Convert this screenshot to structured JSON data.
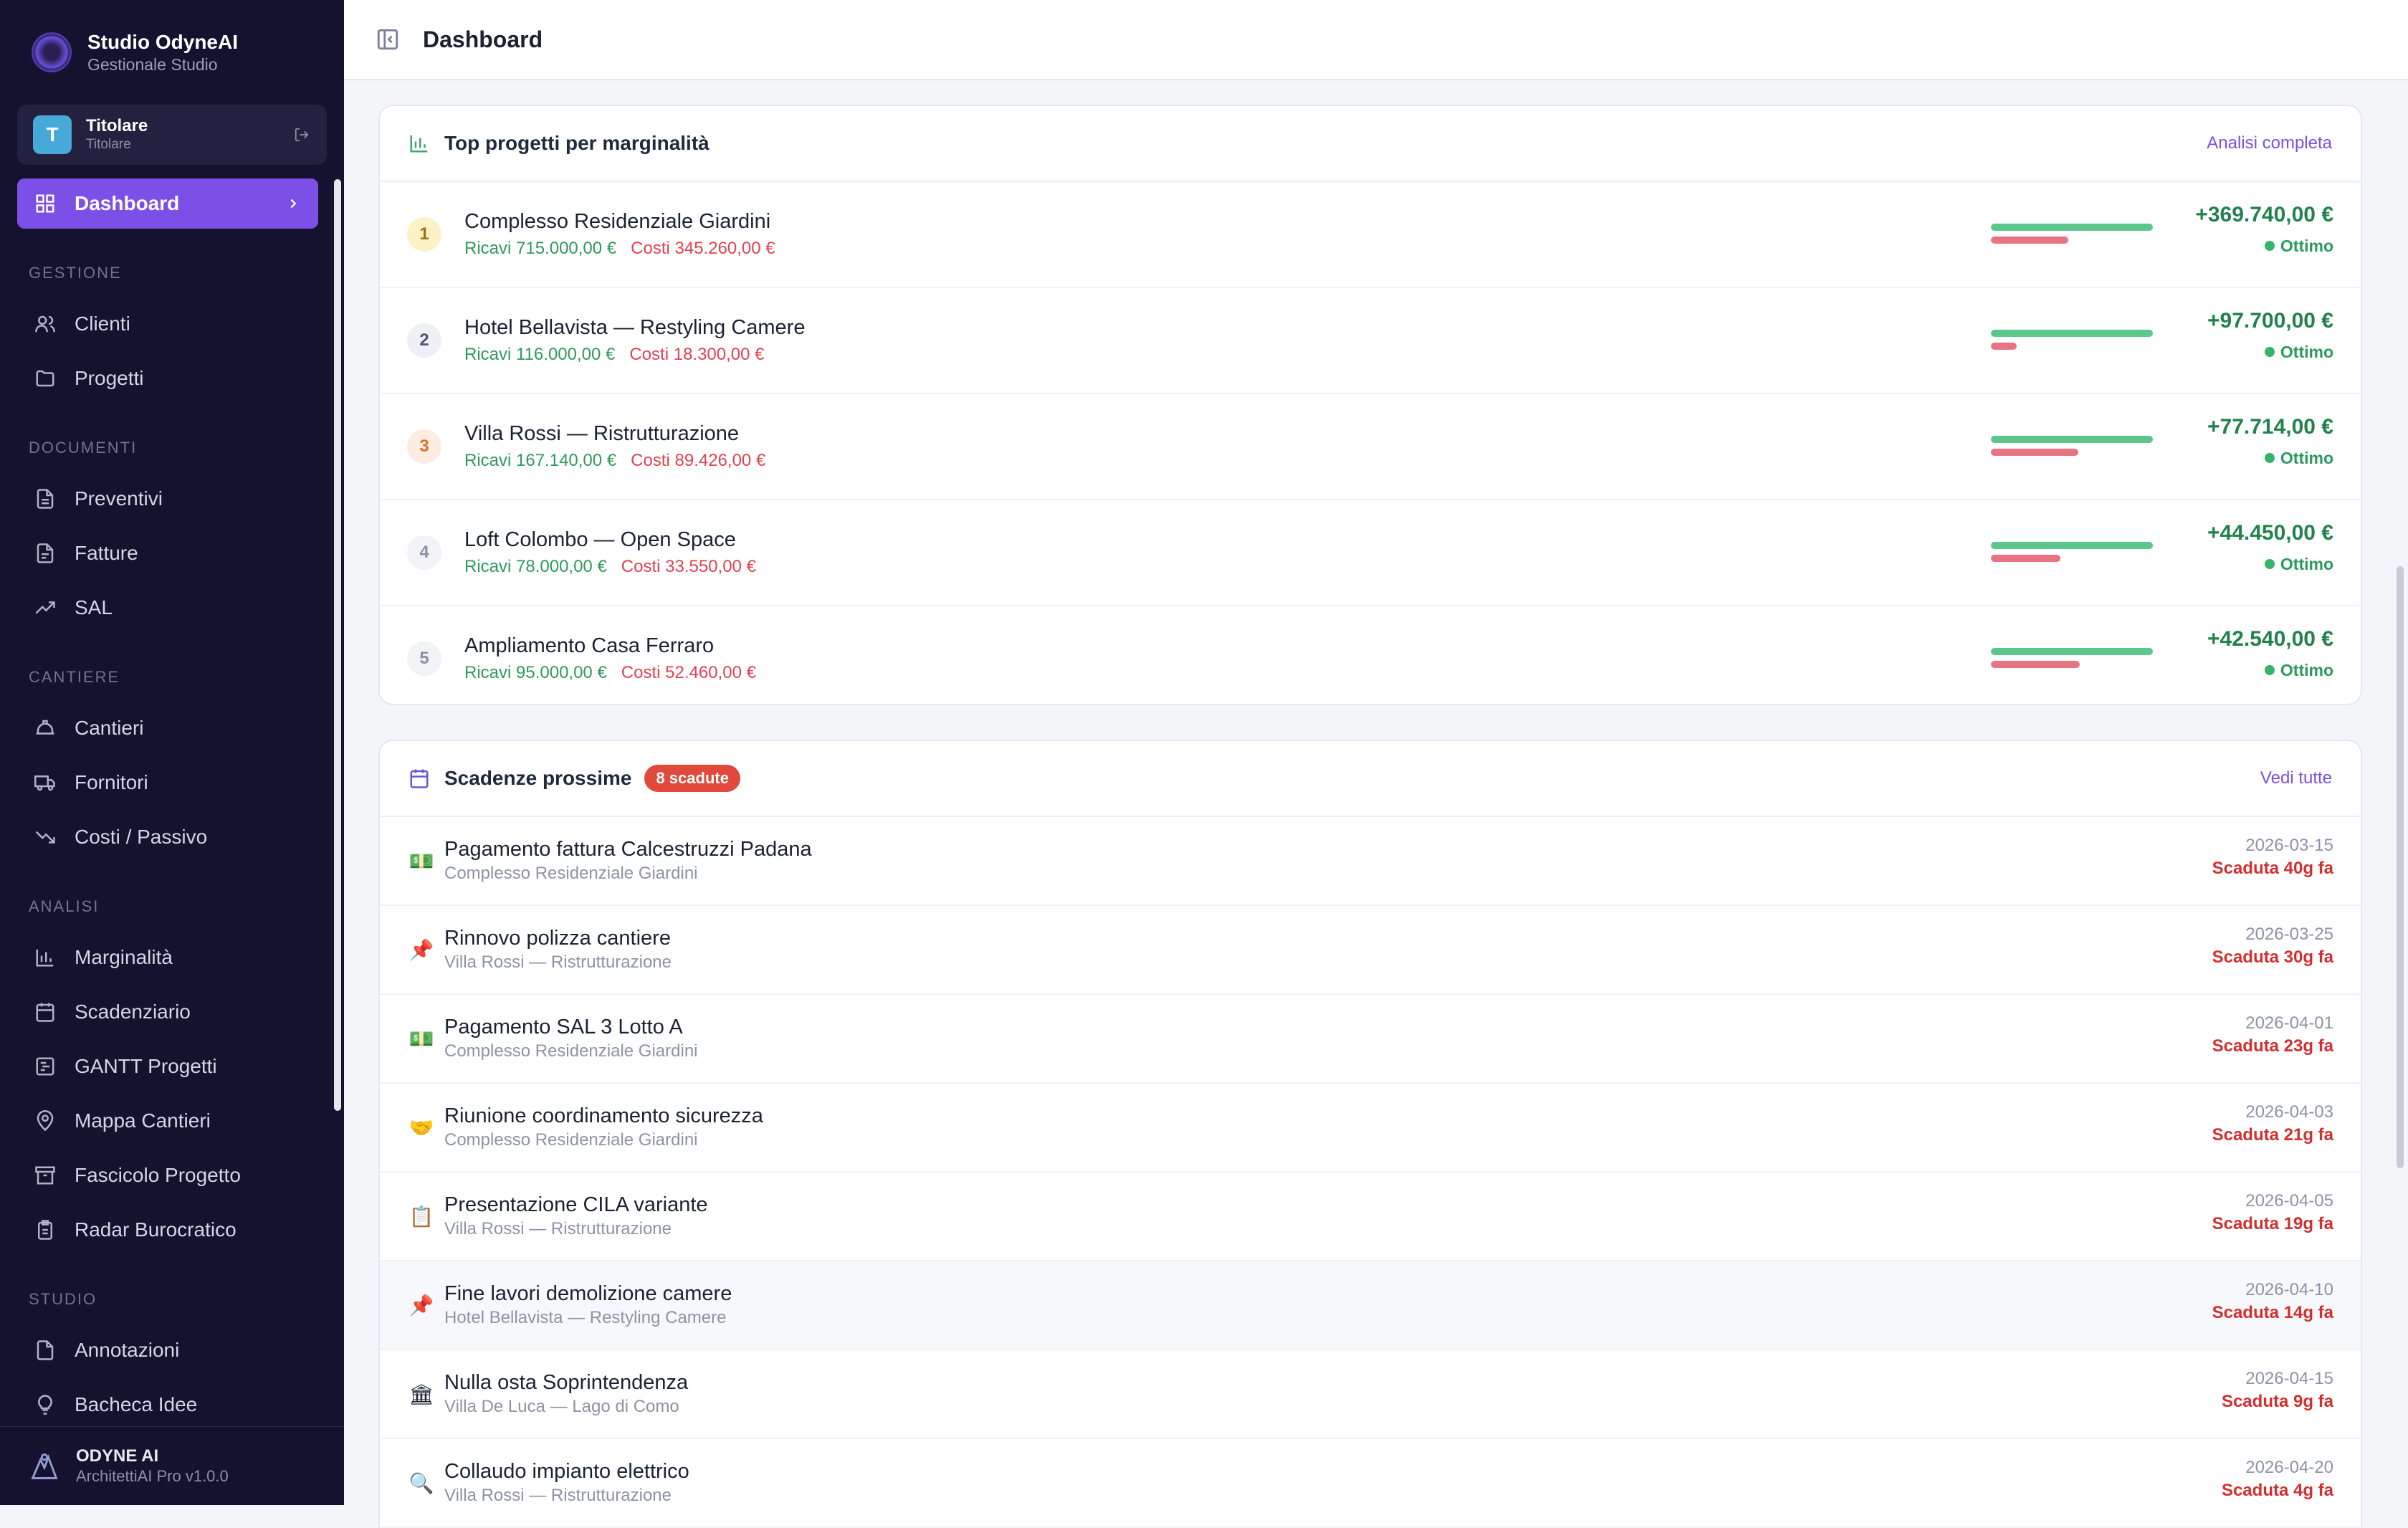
{
  "brand": {
    "title": "Studio OdyneAI",
    "subtitle": "Gestionale Studio"
  },
  "user": {
    "initial": "T",
    "name": "Titolare",
    "role": "Titolare"
  },
  "nav": {
    "active": "Dashboard",
    "sections": [
      {
        "title": "GESTIONE",
        "items": [
          "Clienti",
          "Progetti"
        ]
      },
      {
        "title": "DOCUMENTI",
        "items": [
          "Preventivi",
          "Fatture",
          "SAL"
        ]
      },
      {
        "title": "CANTIERE",
        "items": [
          "Cantieri",
          "Fornitori",
          "Costi / Passivo"
        ]
      },
      {
        "title": "ANALISI",
        "items": [
          "Marginalità",
          "Scadenziario",
          "GANTT Progetti",
          "Mappa Cantieri",
          "Fascicolo Progetto",
          "Radar Burocratico"
        ]
      },
      {
        "title": "STUDIO",
        "items": [
          "Annotazioni",
          "Bacheca Idee"
        ]
      }
    ]
  },
  "footer": {
    "title": "ODYNE AI",
    "subtitle": "ArchitettiAI Pro v1.0.0"
  },
  "topbar": {
    "title": "Dashboard"
  },
  "top_projects": {
    "title": "Top progetti per marginalità",
    "link": "Analisi completa",
    "rows": [
      {
        "rank": "1",
        "name": "Complesso Residenziale Giardini",
        "ricavi": "Ricavi 715.000,00 €",
        "costi": "Costi 345.260,00 €",
        "margin": "+369.740,00 €",
        "status": "Ottimo",
        "revenue_share": 1.0,
        "cost_share": 0.48
      },
      {
        "rank": "2",
        "name": "Hotel Bellavista — Restyling Camere",
        "ricavi": "Ricavi 116.000,00 €",
        "costi": "Costi 18.300,00 €",
        "margin": "+97.700,00 €",
        "status": "Ottimo",
        "revenue_share": 1.0,
        "cost_share": 0.16
      },
      {
        "rank": "3",
        "name": "Villa Rossi — Ristrutturazione",
        "ricavi": "Ricavi 167.140,00 €",
        "costi": "Costi 89.426,00 €",
        "margin": "+77.714,00 €",
        "status": "Ottimo",
        "revenue_share": 1.0,
        "cost_share": 0.54
      },
      {
        "rank": "4",
        "name": "Loft Colombo — Open Space",
        "ricavi": "Ricavi 78.000,00 €",
        "costi": "Costi 33.550,00 €",
        "margin": "+44.450,00 €",
        "status": "Ottimo",
        "revenue_share": 1.0,
        "cost_share": 0.43
      },
      {
        "rank": "5",
        "name": "Ampliamento Casa Ferraro",
        "ricavi": "Ricavi 95.000,00 €",
        "costi": "Costi 52.460,00 €",
        "margin": "+42.540,00 €",
        "status": "Ottimo",
        "revenue_share": 1.0,
        "cost_share": 0.55
      }
    ]
  },
  "deadlines": {
    "title": "Scadenze prossime",
    "badge": "8 scadute",
    "link": "Vedi tutte",
    "rows": [
      {
        "icon": "💵",
        "title": "Pagamento fattura Calcestruzzi Padana",
        "project": "Complesso Residenziale Giardini",
        "date": "2026-03-15",
        "status": "Scaduta 40g fa"
      },
      {
        "icon": "📌",
        "title": "Rinnovo polizza cantiere",
        "project": "Villa Rossi — Ristrutturazione",
        "date": "2026-03-25",
        "status": "Scaduta 30g fa"
      },
      {
        "icon": "💵",
        "title": "Pagamento SAL 3 Lotto A",
        "project": "Complesso Residenziale Giardini",
        "date": "2026-04-01",
        "status": "Scaduta 23g fa"
      },
      {
        "icon": "🤝",
        "title": "Riunione coordinamento sicurezza",
        "project": "Complesso Residenziale Giardini",
        "date": "2026-04-03",
        "status": "Scaduta 21g fa"
      },
      {
        "icon": "📋",
        "title": "Presentazione CILA variante",
        "project": "Villa Rossi — Ristrutturazione",
        "date": "2026-04-05",
        "status": "Scaduta 19g fa"
      },
      {
        "icon": "📌",
        "title": "Fine lavori demolizione camere",
        "project": "Hotel Bellavista — Restyling Camere",
        "date": "2026-04-10",
        "status": "Scaduta 14g fa"
      },
      {
        "icon": "🏛",
        "title": "Nulla osta Soprintendenza",
        "project": "Villa De Luca — Lago di Como",
        "date": "2026-04-15",
        "status": "Scaduta 9g fa"
      },
      {
        "icon": "🔍",
        "title": "Collaudo impianto elettrico",
        "project": "Villa Rossi — Ristrutturazione",
        "date": "2026-04-20",
        "status": "Scaduta 4g fa"
      }
    ]
  }
}
